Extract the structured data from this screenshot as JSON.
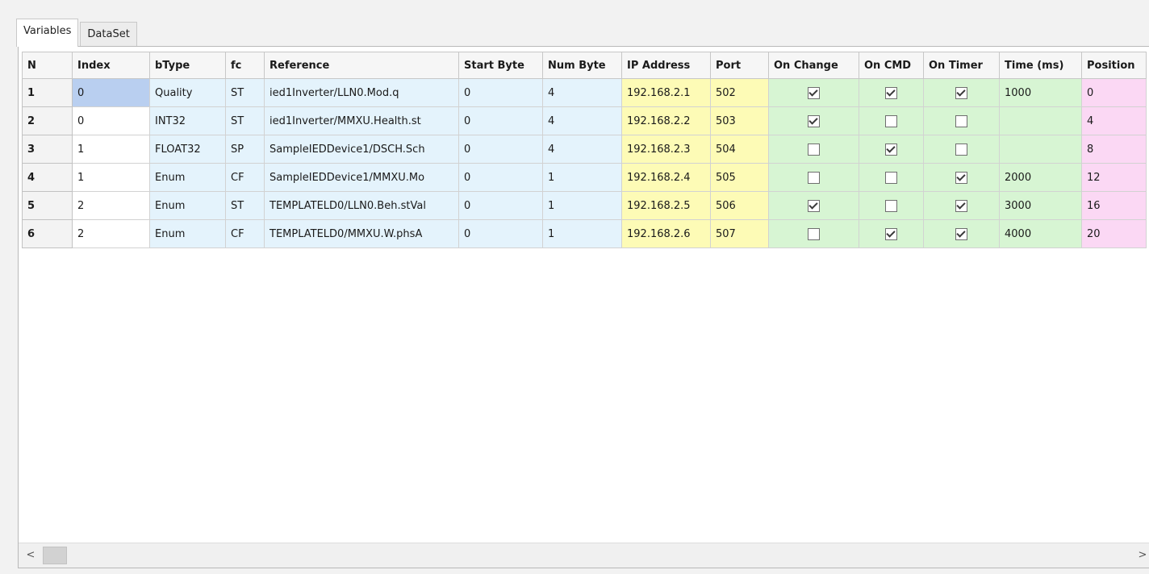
{
  "tabs": [
    {
      "label": "Variables",
      "active": true
    },
    {
      "label": "DataSet",
      "active": false
    }
  ],
  "columns": [
    "N",
    "Index",
    "bType",
    "fc",
    "Reference",
    "Start Byte",
    "Num Byte",
    "IP Address",
    "Port",
    "On Change",
    "On CMD",
    "On Timer",
    "Time (ms)",
    "Position"
  ],
  "rows": [
    {
      "n": "1",
      "index": "0",
      "btype": "Quality",
      "fc": "ST",
      "reference": "ied1Inverter/LLN0.Mod.q",
      "start_byte": "0",
      "num_byte": "4",
      "ip": "192.168.2.1",
      "port": "502",
      "on_change": true,
      "on_cmd": true,
      "on_timer": true,
      "time_ms": "1000",
      "position": "0"
    },
    {
      "n": "2",
      "index": "0",
      "btype": "INT32",
      "fc": "ST",
      "reference": "ied1Inverter/MMXU.Health.st",
      "start_byte": "0",
      "num_byte": "4",
      "ip": "192.168.2.2",
      "port": "503",
      "on_change": true,
      "on_cmd": false,
      "on_timer": false,
      "time_ms": "",
      "position": "4"
    },
    {
      "n": "3",
      "index": "1",
      "btype": "FLOAT32",
      "fc": "SP",
      "reference": "SampleIEDDevice1/DSCH.Sch",
      "start_byte": "0",
      "num_byte": "4",
      "ip": "192.168.2.3",
      "port": "504",
      "on_change": false,
      "on_cmd": true,
      "on_timer": false,
      "time_ms": "",
      "position": "8"
    },
    {
      "n": "4",
      "index": "1",
      "btype": "Enum",
      "fc": "CF",
      "reference": "SampleIEDDevice1/MMXU.Mo",
      "start_byte": "0",
      "num_byte": "1",
      "ip": "192.168.2.4",
      "port": "505",
      "on_change": false,
      "on_cmd": false,
      "on_timer": true,
      "time_ms": "2000",
      "position": "12"
    },
    {
      "n": "5",
      "index": "2",
      "btype": "Enum",
      "fc": "ST",
      "reference": "TEMPLATELD0/LLN0.Beh.stVal",
      "start_byte": "0",
      "num_byte": "1",
      "ip": "192.168.2.5",
      "port": "506",
      "on_change": true,
      "on_cmd": false,
      "on_timer": true,
      "time_ms": "3000",
      "position": "16"
    },
    {
      "n": "6",
      "index": "2",
      "btype": "Enum",
      "fc": "CF",
      "reference": "TEMPLATELD0/MMXU.W.phsA",
      "start_byte": "0",
      "num_byte": "1",
      "ip": "192.168.2.6",
      "port": "507",
      "on_change": false,
      "on_cmd": true,
      "on_timer": true,
      "time_ms": "4000",
      "position": "20"
    }
  ],
  "scrollbar": {
    "left_arrow": "<",
    "right_arrow": ">"
  },
  "colors": {
    "blue": "#e4f3fc",
    "yellow": "#fdfbb6",
    "green": "#d7f5d3",
    "pink": "#fbd8f4",
    "selected": "#b9cff0"
  }
}
